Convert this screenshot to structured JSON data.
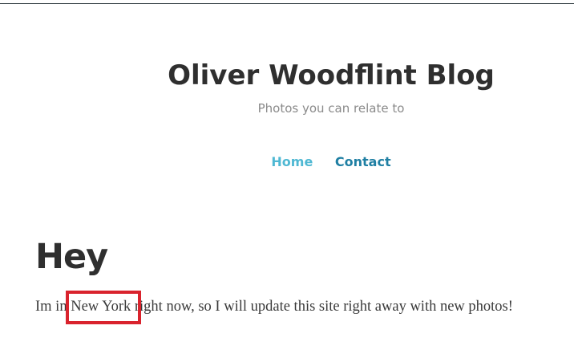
{
  "site": {
    "title": "Oliver Woodflint Blog",
    "tagline": "Photos you can relate to"
  },
  "nav": {
    "items": [
      {
        "label": "Home"
      },
      {
        "label": "Contact"
      }
    ]
  },
  "post": {
    "title": "Hey",
    "body_before": "Im in ",
    "body_highlight": "New York",
    "body_after": " right now, so I will update this site right away with new photos!"
  },
  "colors": {
    "accent_light": "#4fb8d3",
    "accent_dark": "#1f7fa3",
    "highlight_box": "#d9232d"
  }
}
